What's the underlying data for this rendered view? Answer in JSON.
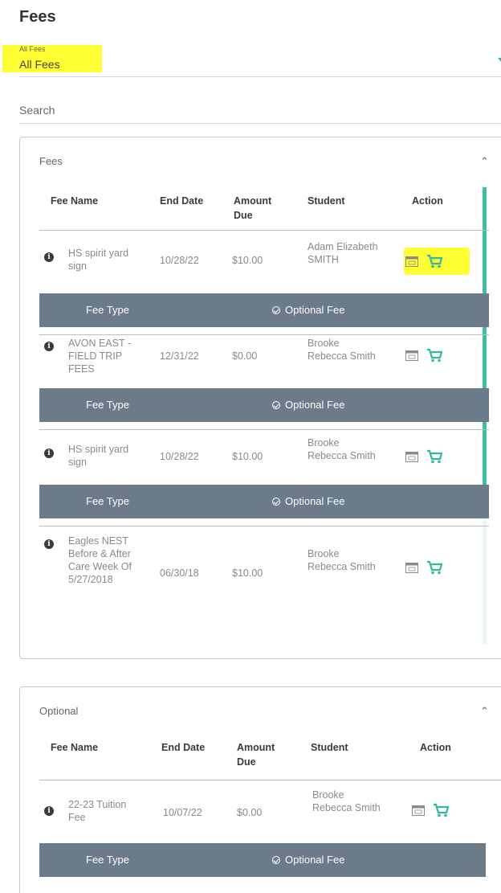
{
  "page": {
    "title": "Fees"
  },
  "filter": {
    "small_label": "All Fees",
    "value": "All Fees"
  },
  "search": {
    "placeholder": "Search"
  },
  "columns": {
    "fee_name": "Fee Name",
    "end_date": "End Date",
    "amount_due": "Amount Due",
    "student": "Student",
    "action": "Action"
  },
  "colors": {
    "accent": "#30b99a",
    "fee_type_bar": "#6b7b8a",
    "highlight": "#ffff33"
  },
  "icons": {
    "calendar": "calendar-icon",
    "cart": "cart-icon",
    "info": "info-icon",
    "collapse": "chevron-up-icon"
  },
  "fees_panel": {
    "title": "Fees",
    "rows": [
      {
        "name": "HS spirit yard sign",
        "end_date": "10/28/22",
        "amount": "$10.00",
        "student": "Adam Elizabeth SMITH",
        "fee_type_label": "Fee Type",
        "fee_type_value": "Optional Fee"
      },
      {
        "name": "AVON EAST - FIELD TRIP FEES",
        "end_date": "12/31/22",
        "amount": "$0.00",
        "student": "Brooke Rebecca Smith",
        "fee_type_label": "Fee Type",
        "fee_type_value": "Optional Fee"
      },
      {
        "name": "HS spirit yard sign",
        "end_date": "10/28/22",
        "amount": "$10.00",
        "student": "Brooke Rebecca Smith",
        "fee_type_label": "Fee Type",
        "fee_type_value": "Optional Fee"
      },
      {
        "name": "Eagles NEST Before & After Care Week Of 5/27/2018",
        "end_date": "06/30/18",
        "amount": "$10.00",
        "student": "Brooke Rebecca Smith"
      }
    ]
  },
  "optional_panel": {
    "title": "Optional",
    "rows": [
      {
        "name": "22-23 Tuition Fee",
        "end_date": "10/07/22",
        "amount": "$0.00",
        "student": "Brooke Rebecca Smith",
        "fee_type_label": "Fee Type",
        "fee_type_value": "Optional Fee"
      }
    ]
  }
}
